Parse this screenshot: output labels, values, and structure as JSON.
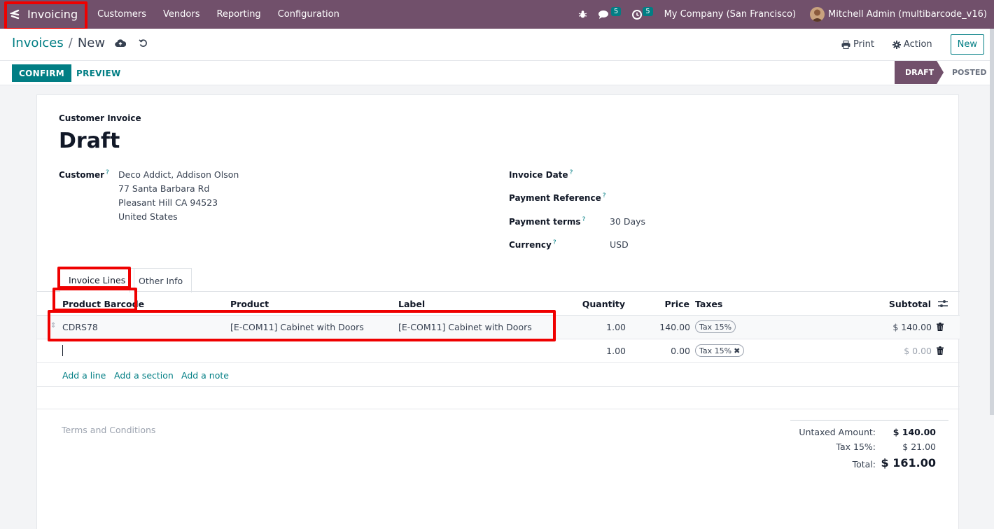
{
  "navbar": {
    "brand": "Invoicing",
    "menu": [
      "Customers",
      "Vendors",
      "Reporting",
      "Configuration"
    ],
    "messages_count": "5",
    "activities_count": "5",
    "company": "My Company (San Francisco)",
    "user": "Mitchell Admin (multibarcode_v16)"
  },
  "control_panel": {
    "breadcrumb_parent": "Invoices",
    "breadcrumb_sep": "/",
    "breadcrumb_current": "New",
    "print_label": "Print",
    "action_label": "Action",
    "new_label": "New"
  },
  "statusbar": {
    "confirm_label": "CONFIRM",
    "preview_label": "PREVIEW",
    "stages": [
      "DRAFT",
      "POSTED"
    ],
    "active_stage": "DRAFT"
  },
  "form": {
    "doc_type": "Customer Invoice",
    "title": "Draft",
    "customer_label": "Customer",
    "help_mark": "?",
    "customer_lines": [
      "Deco Addict, Addison Olson",
      "77 Santa Barbara Rd",
      "Pleasant Hill CA 94523",
      "United States"
    ],
    "invoice_date_label": "Invoice Date",
    "payment_reference_label": "Payment Reference",
    "payment_terms_label": "Payment terms",
    "payment_terms_value": "30 Days",
    "currency_label": "Currency",
    "currency_value": "USD"
  },
  "tabs": [
    "Invoice Lines",
    "Other Info"
  ],
  "lines": {
    "headers": {
      "barcode": "Product Barcode",
      "product": "Product",
      "label": "Label",
      "quantity": "Quantity",
      "price": "Price",
      "taxes": "Taxes",
      "subtotal": "Subtotal"
    },
    "rows": [
      {
        "barcode": "CDRS78",
        "product": "[E-COM11] Cabinet with Doors",
        "label": "[E-COM11] Cabinet with Doors",
        "quantity": "1.00",
        "price": "140.00",
        "tax": "Tax 15%",
        "subtotal": "$ 140.00"
      },
      {
        "barcode": "",
        "product": "",
        "label": "",
        "quantity": "1.00",
        "price": "0.00",
        "tax": "Tax 15%",
        "subtotal": "$ 0.00"
      }
    ],
    "add_line": "Add a line",
    "add_section": "Add a section",
    "add_note": "Add a note"
  },
  "terms_placeholder": "Terms and Conditions",
  "totals": {
    "untaxed_label": "Untaxed Amount:",
    "untaxed_value": "$ 140.00",
    "tax_label": "Tax 15%:",
    "tax_value": "$ 21.00",
    "total_label": "Total:",
    "total_value": "$ 161.00"
  },
  "colors": {
    "brand": "#71506b",
    "accent": "#017e84",
    "highlight": "#ef0000"
  }
}
